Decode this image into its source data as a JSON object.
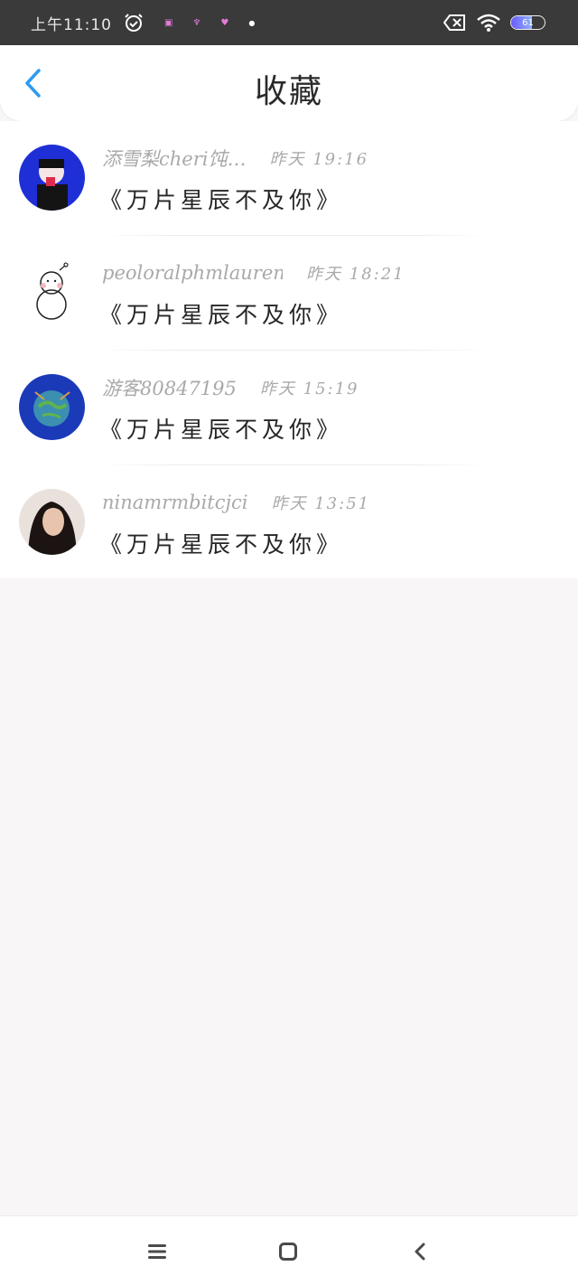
{
  "status_bar": {
    "time": "上午11:10",
    "battery_level": 61,
    "battery_text": "61"
  },
  "header": {
    "title": "收藏",
    "back_icon": "chevron-left-icon"
  },
  "favorites": [
    {
      "name": "添雪梨cheri饨…",
      "time": "昨天 19:16",
      "title": "《万片星辰不及你》",
      "avatar": "anime-avatar"
    },
    {
      "name": "peoloralphmlauren",
      "time": "昨天 18:21",
      "title": "《万片星辰不及你》",
      "avatar": "snowman-avatar"
    },
    {
      "name": "游客80847195",
      "time": "昨天 15:19",
      "title": "《万片星辰不及你》",
      "avatar": "earth-avatar"
    },
    {
      "name": "ninamrmbitcjci",
      "time": "昨天 13:51",
      "title": "《万片星辰不及你》",
      "avatar": "photo-avatar"
    }
  ],
  "nav_bar": {
    "menu_icon": "menu-icon",
    "home_icon": "home-icon",
    "back_icon": "back-icon"
  },
  "colors": {
    "accent": "#2e9bf0",
    "status_bg": "#3a3a3a",
    "page_bg": "#f8f6f7"
  }
}
